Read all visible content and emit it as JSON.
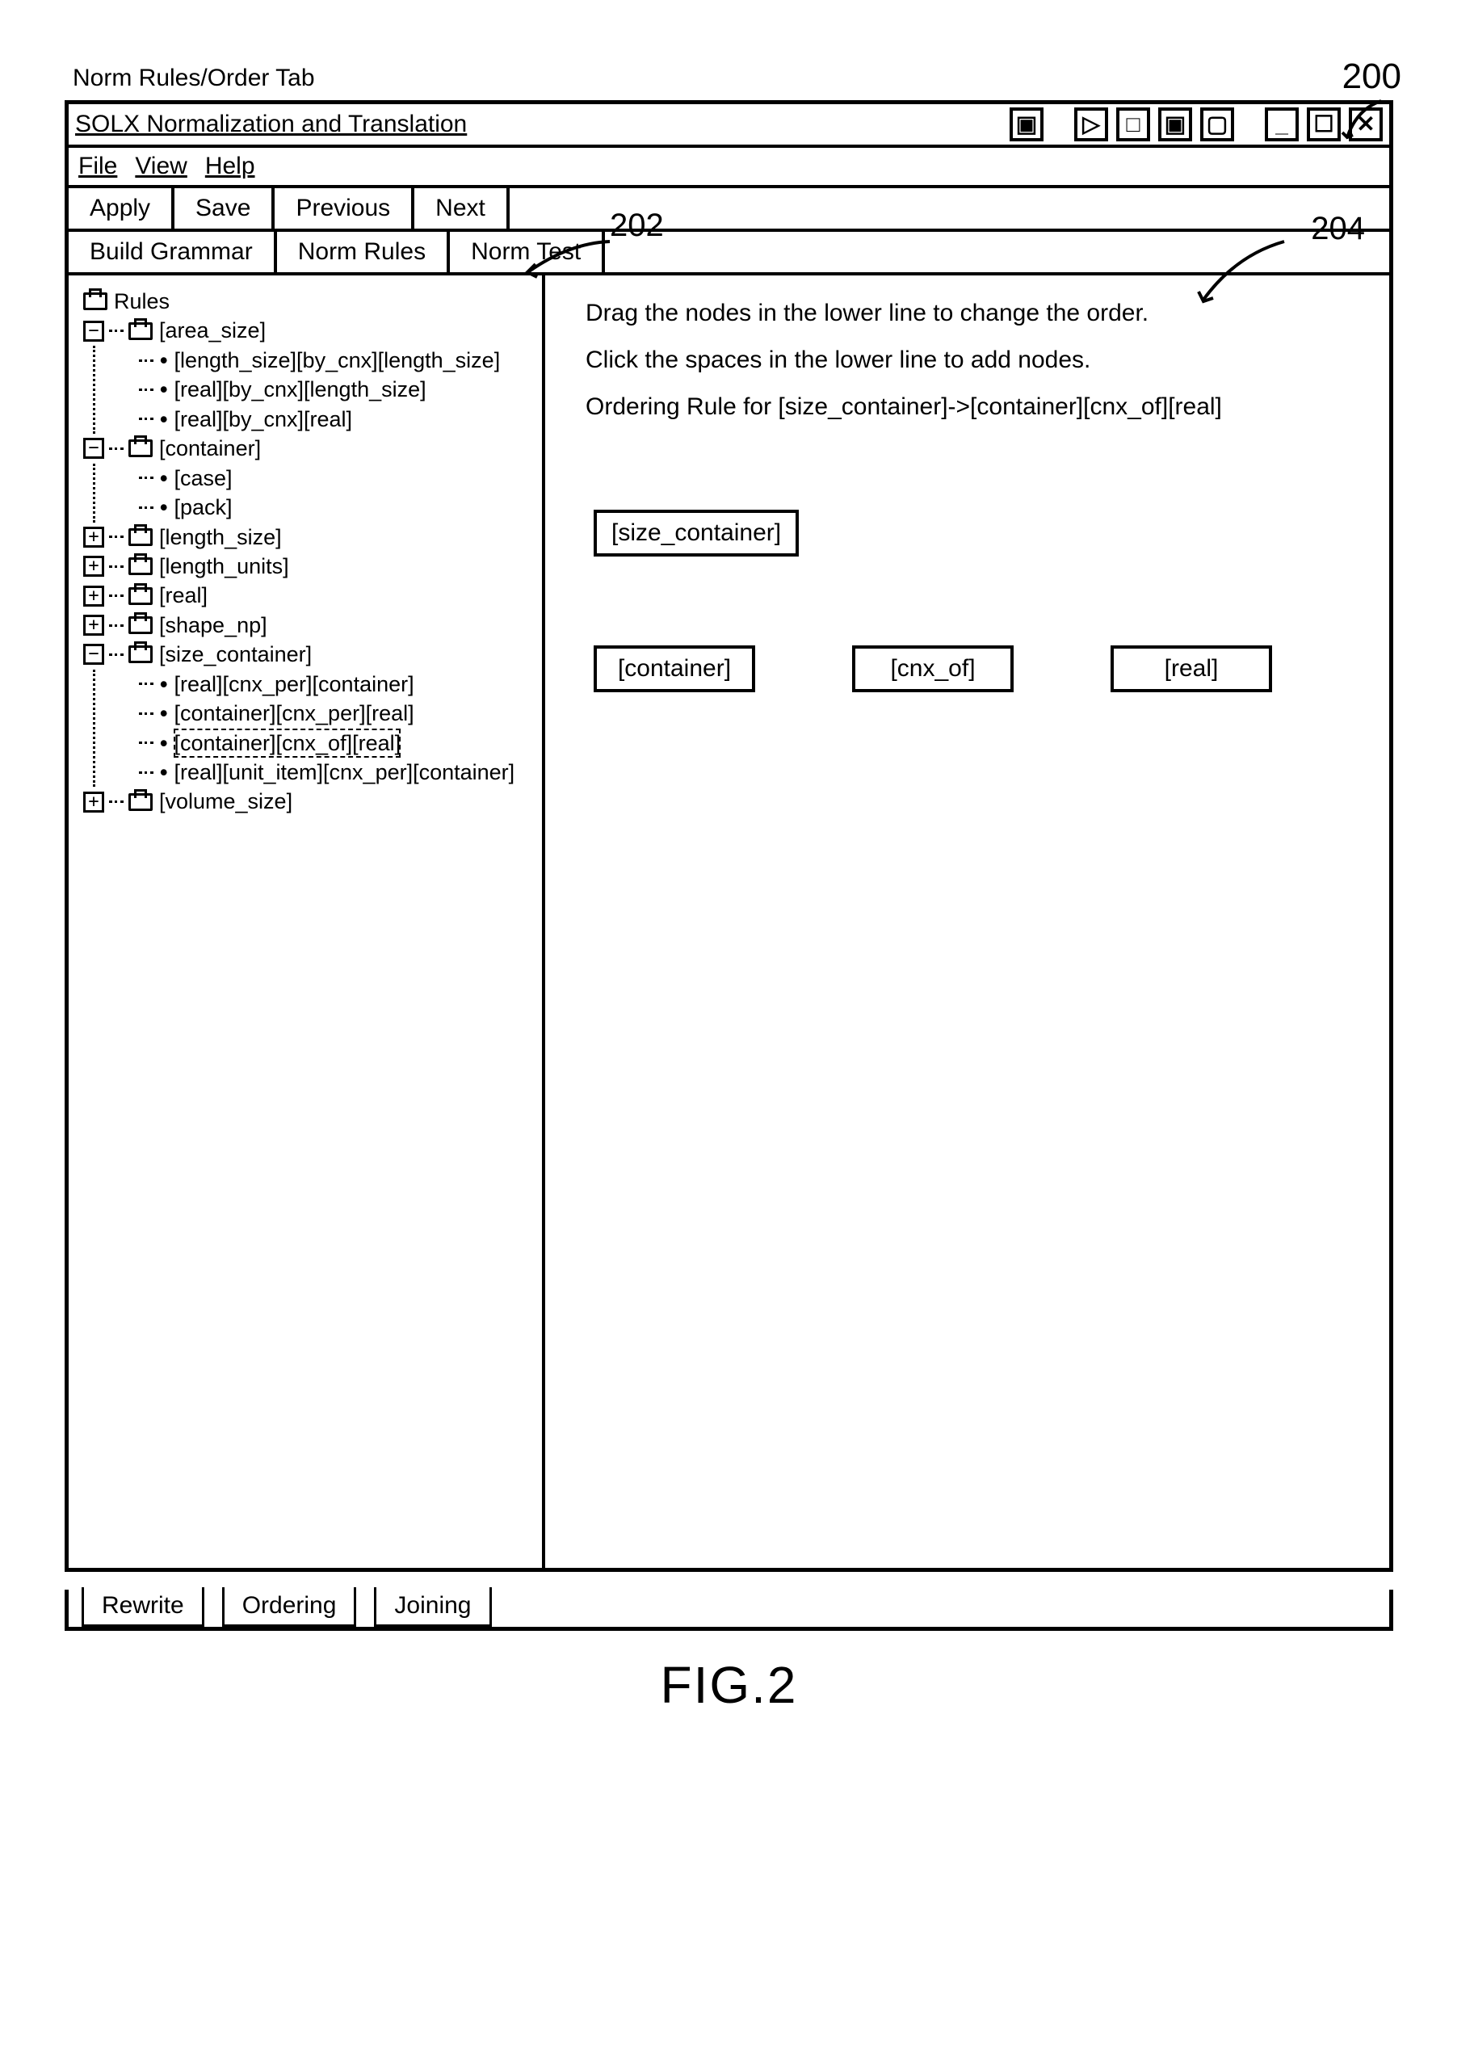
{
  "outer_label": "Norm Rules/Order Tab",
  "title": "SOLX Normalization and Translation",
  "menu": {
    "file": "File",
    "view": "View",
    "help": "Help"
  },
  "toolbar_primary": {
    "apply": "Apply",
    "save": "Save",
    "previous": "Previous",
    "next": "Next"
  },
  "toolbar_secondary": {
    "build_grammar": "Build Grammar",
    "norm_rules": "Norm Rules",
    "norm_test": "Norm Test"
  },
  "tree": {
    "root_label": "Rules",
    "area_size": {
      "label": "[area_size]",
      "children": [
        "[length_size][by_cnx][length_size]",
        "[real][by_cnx][length_size]",
        "[real][by_cnx][real]"
      ]
    },
    "container": {
      "label": "[container]",
      "children": [
        "[case]",
        "[pack]"
      ]
    },
    "length_size": {
      "label": "[length_size]"
    },
    "length_units": {
      "label": "[length_units]"
    },
    "real": {
      "label": "[real]"
    },
    "shape_np": {
      "label": "[shape_np]"
    },
    "size_container": {
      "label": "[size_container]",
      "children": [
        "[real][cnx_per][container]",
        "[container][cnx_per][real]",
        "[container][cnx_of][real]",
        "[real][unit_item][cnx_per][container]"
      ]
    },
    "volume_size": {
      "label": "[volume_size]"
    }
  },
  "editor": {
    "hint_drag": "Drag the nodes in the lower line to change the order.",
    "hint_click": "Click the spaces in the lower line to add nodes.",
    "rule_label": "Ordering Rule for [size_container]->[container][cnx_of][real]",
    "top_token": "[size_container]",
    "tokens": [
      "[container]",
      "[cnx_of]",
      "[real]"
    ]
  },
  "bottom_tabs": {
    "rewrite": "Rewrite",
    "ordering": "Ordering",
    "joining": "Joining"
  },
  "callouts": {
    "c200": "200",
    "c202": "202",
    "c204": "204",
    "fig": "FIG.2"
  },
  "win_icons": {
    "min": "_",
    "max": "☐",
    "close": "✕",
    "dup1": "▷",
    "dup2": "□",
    "dup3": "▣",
    "dup4": "▢"
  }
}
